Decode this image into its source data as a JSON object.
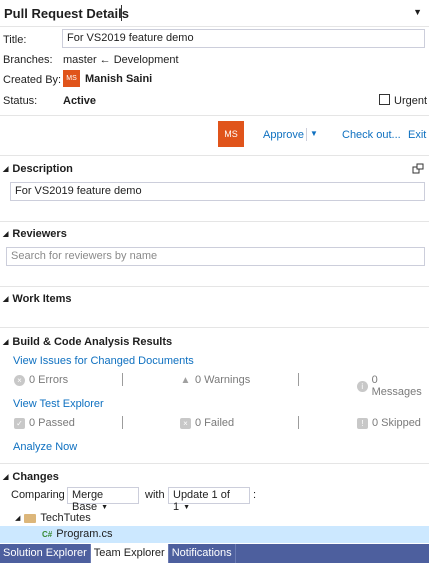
{
  "header": {
    "title": "Pull Request Details"
  },
  "details": {
    "title_label": "Title:",
    "title_value": "For VS2019 feature demo",
    "branches_label": "Branches:",
    "branches_value": "master ← Development",
    "created_by_label": "Created By:",
    "creator_initials": "MS",
    "creator_name": "Manish Saini",
    "status_label": "Status:",
    "status_value": "Active",
    "urgent_label": "Urgent"
  },
  "actions": {
    "avatar_initials": "MS",
    "approve": "Approve",
    "checkout": "Check out...",
    "exit": "Exit"
  },
  "description": {
    "heading": "Description",
    "text": "For VS2019 feature demo"
  },
  "reviewers": {
    "heading": "Reviewers",
    "placeholder": "Search for reviewers by name"
  },
  "work_items": {
    "heading": "Work Items"
  },
  "build": {
    "heading": "Build & Code Analysis Results",
    "view_issues": "View Issues for Changed Documents",
    "errors": "0 Errors",
    "warnings": "0 Warnings",
    "messages": "0 Messages",
    "view_test_explorer": "View Test Explorer",
    "passed": "0 Passed",
    "failed": "0 Failed",
    "skipped": "0 Skipped",
    "analyze_now": "Analyze Now"
  },
  "changes": {
    "heading": "Changes",
    "comparing_label": "Comparing",
    "compare_from": "Merge Base",
    "with_label": "with",
    "compare_to": "Update 1 of 1",
    "colon": ":",
    "folder": "TechTutes",
    "file": "Program.cs"
  },
  "tabs": [
    {
      "label": "Solution Explorer"
    },
    {
      "label": "Team Explorer"
    },
    {
      "label": "Notifications"
    }
  ],
  "colors": {
    "accent_link": "#0e70c0",
    "avatar_bg": "#e0541b",
    "tabbar_bg": "#4d5f9e",
    "selection": "#cce8ff"
  }
}
